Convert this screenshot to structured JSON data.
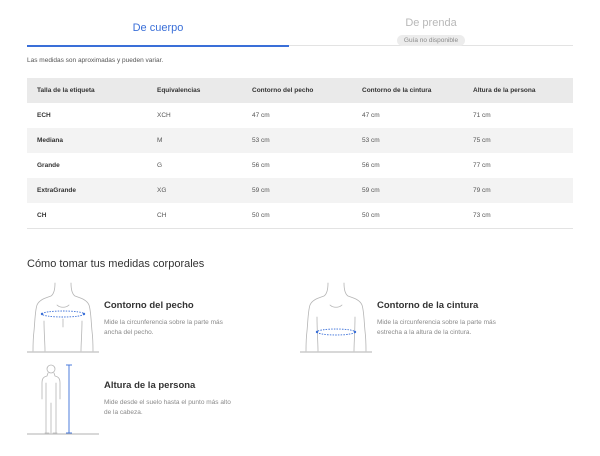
{
  "tabs": {
    "body": {
      "label": "De cuerpo"
    },
    "garment": {
      "label": "De prenda",
      "badge": "Guía no disponible"
    }
  },
  "note": "Las medidas son aproximadas y pueden variar.",
  "table": {
    "headers": [
      "Talla de la etiqueta",
      "Equivalencias",
      "Contorno del pecho",
      "Contorno de la cintura",
      "Altura de la persona"
    ],
    "rows": [
      [
        "ECH",
        "XCH",
        "47 cm",
        "47 cm",
        "71 cm"
      ],
      [
        "Mediana",
        "M",
        "53 cm",
        "53 cm",
        "75 cm"
      ],
      [
        "Grande",
        "G",
        "56 cm",
        "56 cm",
        "77 cm"
      ],
      [
        "ExtraGrande",
        "XG",
        "59 cm",
        "59 cm",
        "79 cm"
      ],
      [
        "CH",
        "CH",
        "50 cm",
        "50 cm",
        "73 cm"
      ]
    ]
  },
  "howto": {
    "title": "Cómo tomar tus medidas corporales",
    "chest": {
      "title": "Contorno del pecho",
      "desc": "Mide la circunferencia sobre la parte más ancha del pecho.",
      "icon": "chest-measure-icon"
    },
    "waist": {
      "title": "Contorno de la cintura",
      "desc": "Mide la circunferencia sobre la parte más estrecha a la altura de la cintura.",
      "icon": "waist-measure-icon"
    },
    "height": {
      "title": "Altura de la persona",
      "desc": "Mide desde el suelo hasta el punto más alto de la cabeza.",
      "icon": "height-measure-icon"
    }
  },
  "colors": {
    "accent": "#3a6fd8",
    "header_bg": "#eaeaea",
    "row_alt": "#f3f3f3"
  }
}
